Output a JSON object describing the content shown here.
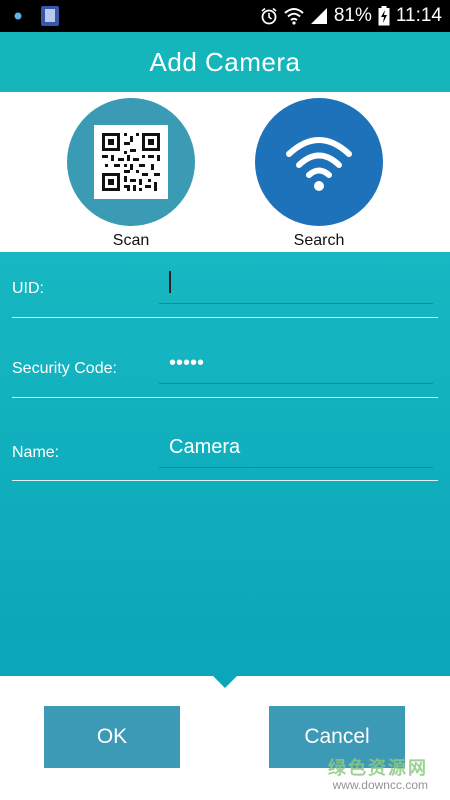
{
  "status_bar": {
    "battery": "81%",
    "time": "11:14",
    "icons": [
      "notification-dot-icon",
      "phone-app-icon",
      "alarm-icon",
      "wifi-icon",
      "signal-icon",
      "battery-charging-icon"
    ]
  },
  "header": {
    "title": "Add Camera"
  },
  "methods": {
    "scan_label": "Scan",
    "search_label": "Search",
    "scan_icon": "qr-code-icon",
    "search_icon": "wifi-icon"
  },
  "form": {
    "uid": {
      "label": "UID:",
      "value": ""
    },
    "security": {
      "label": "Security Code:",
      "value": "•••••"
    },
    "name": {
      "label": "Name:",
      "value": "Camera"
    }
  },
  "buttons": {
    "ok_label": "OK",
    "cancel_label": "Cancel"
  },
  "watermark": {
    "text": "绿色资源网",
    "url": "www.downcc.com"
  },
  "colors": {
    "title_bar": "#14b6bb",
    "form_bg": "#0ba7b9",
    "scan_circle": "#3b9bb4",
    "search_circle": "#1e72b9",
    "button_bg": "#3d9ab7"
  }
}
